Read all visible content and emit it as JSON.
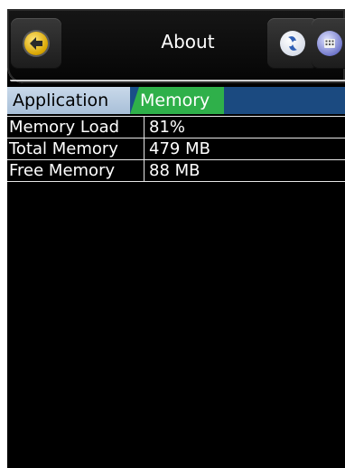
{
  "header": {
    "title": "About",
    "back_icon": "back-arrow-icon",
    "sync_icon": "sync-icon",
    "menu_icon": "keypad-menu-icon"
  },
  "tabs": [
    {
      "label": "Application",
      "selected": false
    },
    {
      "label": "Memory",
      "selected": true
    }
  ],
  "memory_table": {
    "rows": [
      {
        "label": "Memory Load",
        "value": "81%"
      },
      {
        "label": "Total Memory",
        "value": "479 MB"
      },
      {
        "label": "Free Memory",
        "value": "88 MB"
      }
    ]
  },
  "colors": {
    "active_tab": "#2fb04a",
    "inactive_tab": "#b6cae0",
    "tab_strip": "#1b4a80",
    "background": "#000000"
  }
}
